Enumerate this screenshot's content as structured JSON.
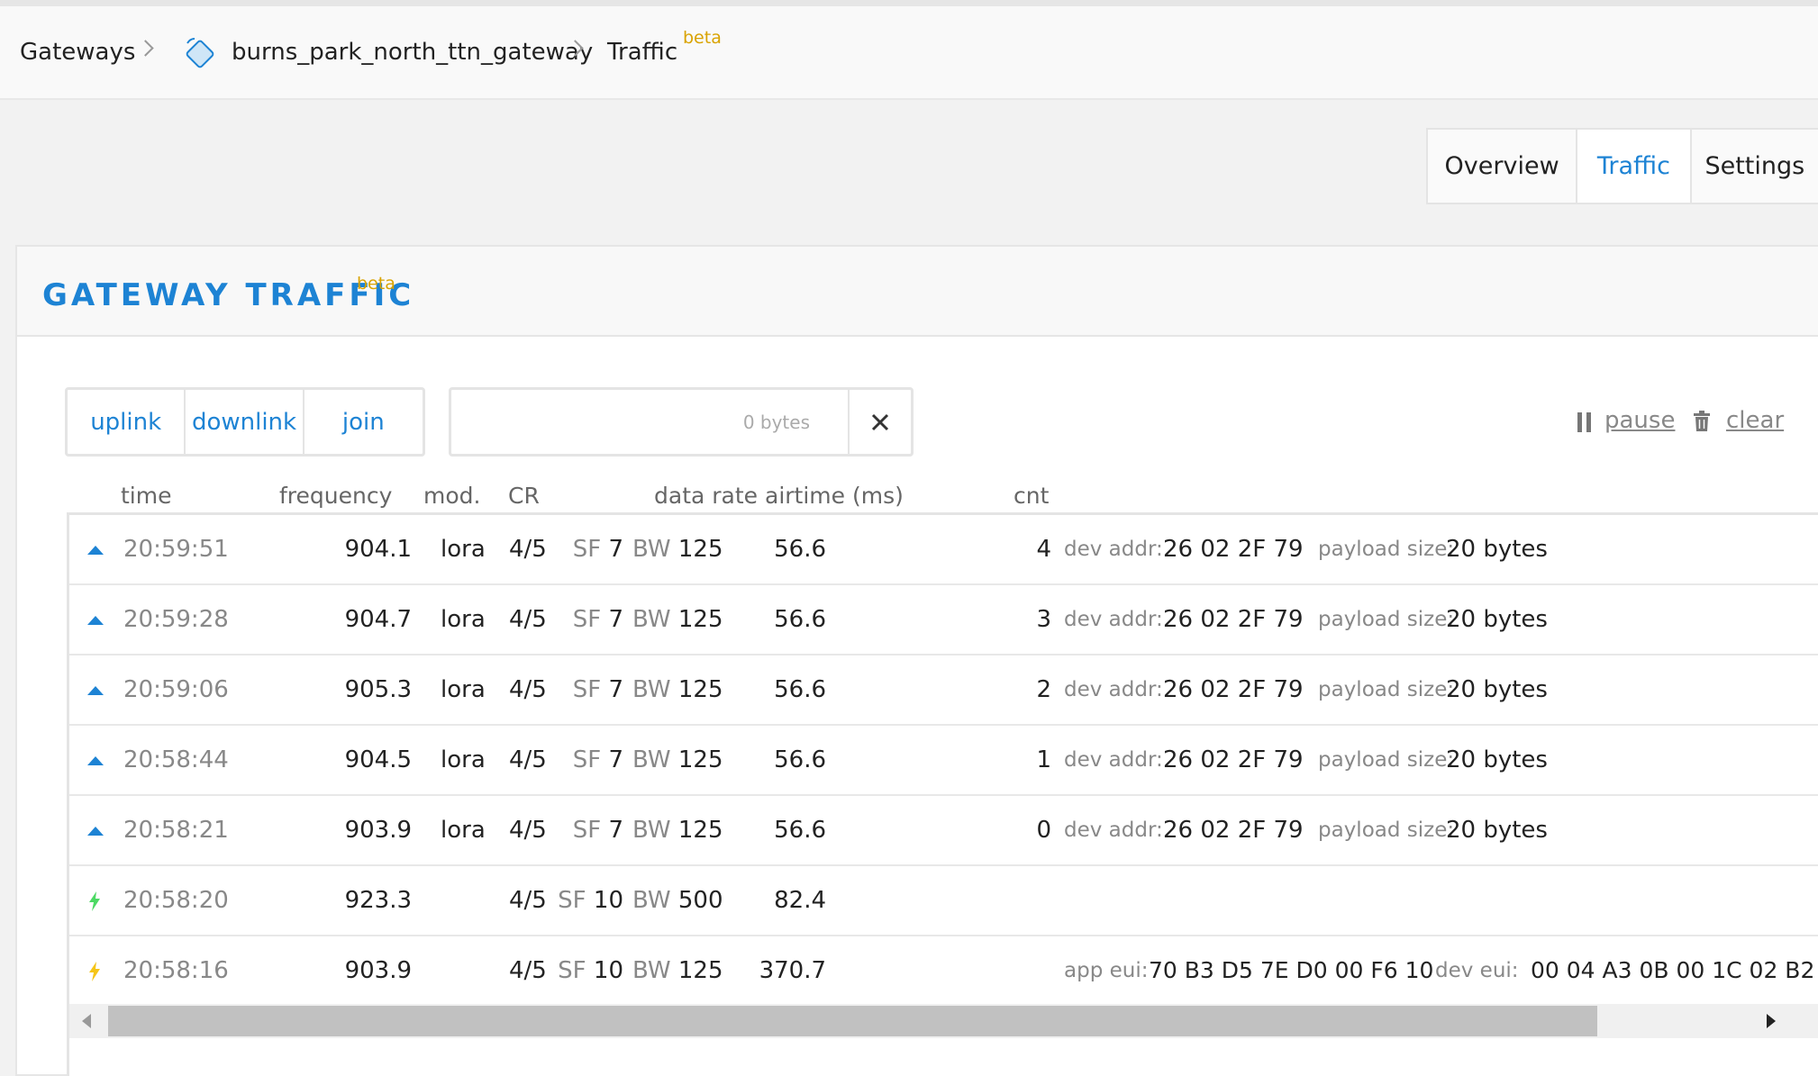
{
  "breadcrumb": {
    "gateways": "Gateways",
    "gateway_id": "burns_park_north_ttn_gateway",
    "current": "Traffic",
    "beta": "beta"
  },
  "tabs": [
    {
      "label": "Overview",
      "active": false
    },
    {
      "label": "Traffic",
      "active": true
    },
    {
      "label": "Settings",
      "active": false
    }
  ],
  "card": {
    "title": "GATEWAY TRAFFIC",
    "beta": "beta"
  },
  "filters": {
    "uplink": "uplink",
    "downlink": "downlink",
    "join": "join"
  },
  "search": {
    "value": "",
    "bytes": "0 bytes"
  },
  "actions": {
    "pause": "pause",
    "clear": "clear"
  },
  "columns": {
    "time": "time",
    "frequency": "frequency",
    "mod": "mod.",
    "cr": "CR",
    "data_rate": "data rate",
    "airtime": "airtime (ms)",
    "cnt": "cnt"
  },
  "labels": {
    "dev_addr": "dev addr:",
    "payload_size": "payload size:",
    "app_eui": "app eui:",
    "dev_eui": "dev eui:",
    "sf": "SF",
    "bw": "BW"
  },
  "rows": [
    {
      "kind": "uplink",
      "time": "20:59:51",
      "frequency": "904.1",
      "mod": "lora",
      "cr": "4/5",
      "sf": "7",
      "bw": "125",
      "airtime": "56.6",
      "cnt": "4",
      "dev_addr": "26 02 2F 79",
      "payload_size": "20 bytes"
    },
    {
      "kind": "uplink",
      "time": "20:59:28",
      "frequency": "904.7",
      "mod": "lora",
      "cr": "4/5",
      "sf": "7",
      "bw": "125",
      "airtime": "56.6",
      "cnt": "3",
      "dev_addr": "26 02 2F 79",
      "payload_size": "20 bytes"
    },
    {
      "kind": "uplink",
      "time": "20:59:06",
      "frequency": "905.3",
      "mod": "lora",
      "cr": "4/5",
      "sf": "7",
      "bw": "125",
      "airtime": "56.6",
      "cnt": "2",
      "dev_addr": "26 02 2F 79",
      "payload_size": "20 bytes"
    },
    {
      "kind": "uplink",
      "time": "20:58:44",
      "frequency": "904.5",
      "mod": "lora",
      "cr": "4/5",
      "sf": "7",
      "bw": "125",
      "airtime": "56.6",
      "cnt": "1",
      "dev_addr": "26 02 2F 79",
      "payload_size": "20 bytes"
    },
    {
      "kind": "uplink",
      "time": "20:58:21",
      "frequency": "903.9",
      "mod": "lora",
      "cr": "4/5",
      "sf": "7",
      "bw": "125",
      "airtime": "56.6",
      "cnt": "0",
      "dev_addr": "26 02 2F 79",
      "payload_size": "20 bytes"
    },
    {
      "kind": "downlink",
      "time": "20:58:20",
      "frequency": "923.3",
      "mod": "",
      "cr": "4/5",
      "sf": "10",
      "bw": "500",
      "airtime": "82.4"
    },
    {
      "kind": "join",
      "time": "20:58:16",
      "frequency": "903.9",
      "mod": "",
      "cr": "4/5",
      "sf": "10",
      "bw": "125",
      "airtime": "370.7",
      "app_eui": "70 B3 D5 7E D0 00 F6 10",
      "dev_eui": "00 04 A3 0B 00 1C 02 B2"
    }
  ],
  "icons": {
    "uplink": "arrow-up-icon",
    "downlink": "bolt-icon",
    "join": "bolt-icon",
    "gateway": "gateway-icon",
    "pause": "pause-icon",
    "clear": "trash-icon",
    "close": "close-icon"
  },
  "colors": {
    "accent": "#1d83d4",
    "beta": "#d9a300",
    "downlink_bolt": "#4cd964",
    "join_bolt": "#f5c518"
  },
  "scroll_position": 0
}
